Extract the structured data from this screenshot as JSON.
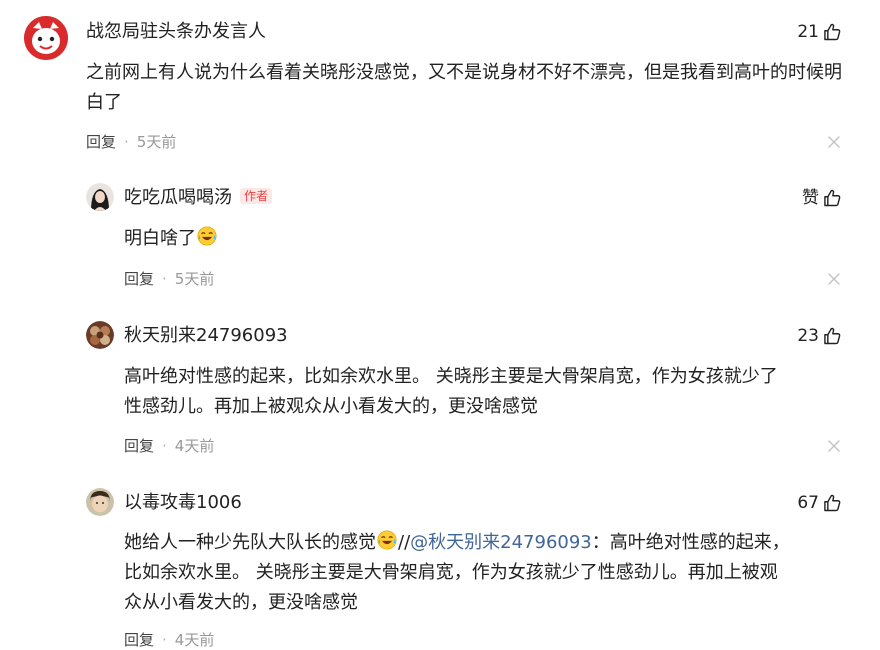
{
  "comments": [
    {
      "username": "战忽局驻头条办发言人",
      "likes": "21",
      "text": "之前网上有人说为什么看着关晓彤没感觉，又不是说身材不好不漂亮，但是我看到高叶的时候明白了",
      "reply_label": "回复",
      "separator": "·",
      "time": "5天前",
      "avatar_icon": "cartoon-face-avatar"
    },
    {
      "username": "吃吃瓜喝喝汤",
      "author_tag": "作者",
      "likes": "赞",
      "text": "明白啥了",
      "emoji": "laughing-tears-emoji",
      "reply_label": "回复",
      "separator": "·",
      "time": "5天前",
      "avatar_icon": "woman-portrait-avatar"
    },
    {
      "username": "秋天别来24796093",
      "likes": "23",
      "text_line1": "高叶绝对性感的起来，比如余欢水里。 关晓彤主要是大骨架肩宽，作为女孩就少了",
      "text_line2": "性感劲儿。再加上被观众从小看发大的，更没啥感觉",
      "reply_label": "回复",
      "separator": "·",
      "time": "4天前",
      "avatar_icon": "flower-avatar"
    },
    {
      "username": "以毒攻毒1006",
      "likes": "67",
      "text_line1_a": "她给人一种少先队大队长的感觉",
      "emoji": "laughing-tears-emoji",
      "text_line1_b": "//",
      "mention": "@秋天别来24796093",
      "text_line1_c": "：高叶绝对性感的起来，",
      "text_line2": "比如余欢水里。 关晓彤主要是大骨架肩宽，作为女孩就少了性感劲儿。再加上被观",
      "text_line3": "众从小看发大的，更没啥感觉",
      "reply_label": "回复",
      "separator": "·",
      "time": "4天前",
      "avatar_icon": "child-portrait-avatar"
    }
  ],
  "colors": {
    "text": "#222222",
    "meta": "#999999",
    "mention": "#406599",
    "author_tag": "#f04142",
    "avatar_red": "#d92b2b"
  },
  "icons": [
    "thumbs-up-icon",
    "close-icon"
  ]
}
